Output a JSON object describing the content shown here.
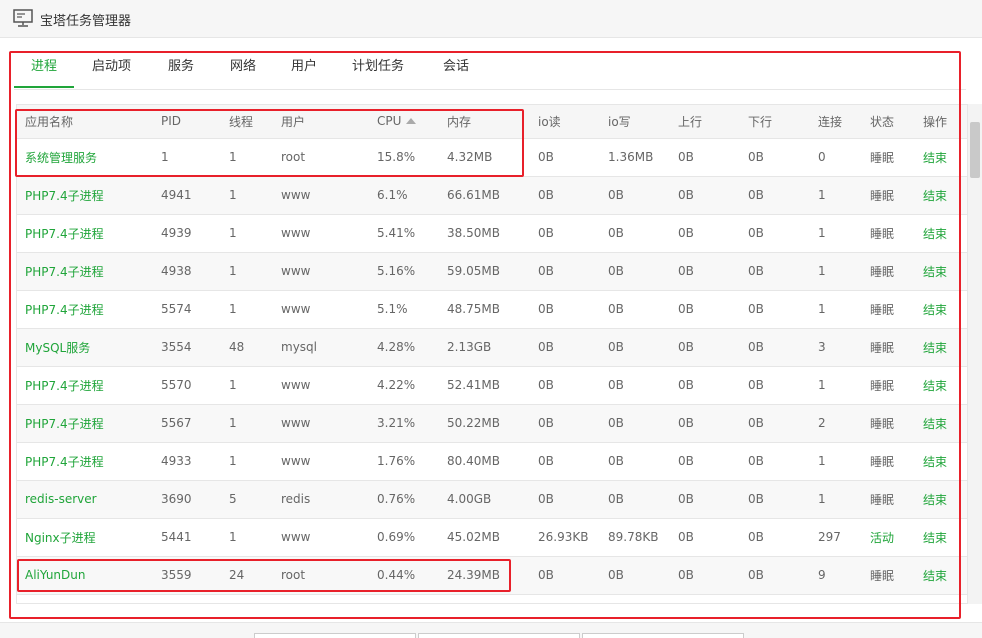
{
  "window": {
    "title": "宝塔任务管理器",
    "icon": "monitor-icon"
  },
  "tabs": [
    {
      "label": "进程",
      "active": true
    },
    {
      "label": "启动项",
      "active": false
    },
    {
      "label": "服务",
      "active": false
    },
    {
      "label": "网络",
      "active": false
    },
    {
      "label": "用户",
      "active": false
    },
    {
      "label": "计划任务",
      "active": false
    },
    {
      "label": "会话",
      "active": false
    }
  ],
  "table": {
    "columns": [
      "应用名称",
      "PID",
      "线程",
      "用户",
      "CPU",
      "内存",
      "io读",
      "io写",
      "上行",
      "下行",
      "连接",
      "状态",
      "操作"
    ],
    "sort_column": "CPU",
    "sort_icon": "sort-up-icon",
    "rows": [
      [
        "系统管理服务",
        "1",
        "1",
        "root",
        "15.8%",
        "4.32MB",
        "0B",
        "1.36MB",
        "0B",
        "0B",
        "0",
        "睡眠",
        "结束"
      ],
      [
        "PHP7.4子进程",
        "4941",
        "1",
        "www",
        "6.1%",
        "66.61MB",
        "0B",
        "0B",
        "0B",
        "0B",
        "1",
        "睡眠",
        "结束"
      ],
      [
        "PHP7.4子进程",
        "4939",
        "1",
        "www",
        "5.41%",
        "38.50MB",
        "0B",
        "0B",
        "0B",
        "0B",
        "1",
        "睡眠",
        "结束"
      ],
      [
        "PHP7.4子进程",
        "4938",
        "1",
        "www",
        "5.16%",
        "59.05MB",
        "0B",
        "0B",
        "0B",
        "0B",
        "1",
        "睡眠",
        "结束"
      ],
      [
        "PHP7.4子进程",
        "5574",
        "1",
        "www",
        "5.1%",
        "48.75MB",
        "0B",
        "0B",
        "0B",
        "0B",
        "1",
        "睡眠",
        "结束"
      ],
      [
        "MySQL服务",
        "3554",
        "48",
        "mysql",
        "4.28%",
        "2.13GB",
        "0B",
        "0B",
        "0B",
        "0B",
        "3",
        "睡眠",
        "结束"
      ],
      [
        "PHP7.4子进程",
        "5570",
        "1",
        "www",
        "4.22%",
        "52.41MB",
        "0B",
        "0B",
        "0B",
        "0B",
        "1",
        "睡眠",
        "结束"
      ],
      [
        "PHP7.4子进程",
        "5567",
        "1",
        "www",
        "3.21%",
        "50.22MB",
        "0B",
        "0B",
        "0B",
        "0B",
        "2",
        "睡眠",
        "结束"
      ],
      [
        "PHP7.4子进程",
        "4933",
        "1",
        "www",
        "1.76%",
        "80.40MB",
        "0B",
        "0B",
        "0B",
        "0B",
        "1",
        "睡眠",
        "结束"
      ],
      [
        "redis-server",
        "3690",
        "5",
        "redis",
        "0.76%",
        "4.00GB",
        "0B",
        "0B",
        "0B",
        "0B",
        "1",
        "睡眠",
        "结束"
      ],
      [
        "Nginx子进程",
        "5441",
        "1",
        "www",
        "0.69%",
        "45.02MB",
        "26.93KB",
        "89.78KB",
        "0B",
        "0B",
        "297",
        "活动",
        "结束"
      ],
      [
        "AliYunDun",
        "3559",
        "24",
        "root",
        "0.44%",
        "24.39MB",
        "0B",
        "0B",
        "0B",
        "0B",
        "9",
        "睡眠",
        "结束"
      ]
    ]
  },
  "colors": {
    "accent": "#20a53a",
    "highlight": "#e8202a",
    "header_bg": "#f6f6f6",
    "border": "#e6e6e6"
  }
}
